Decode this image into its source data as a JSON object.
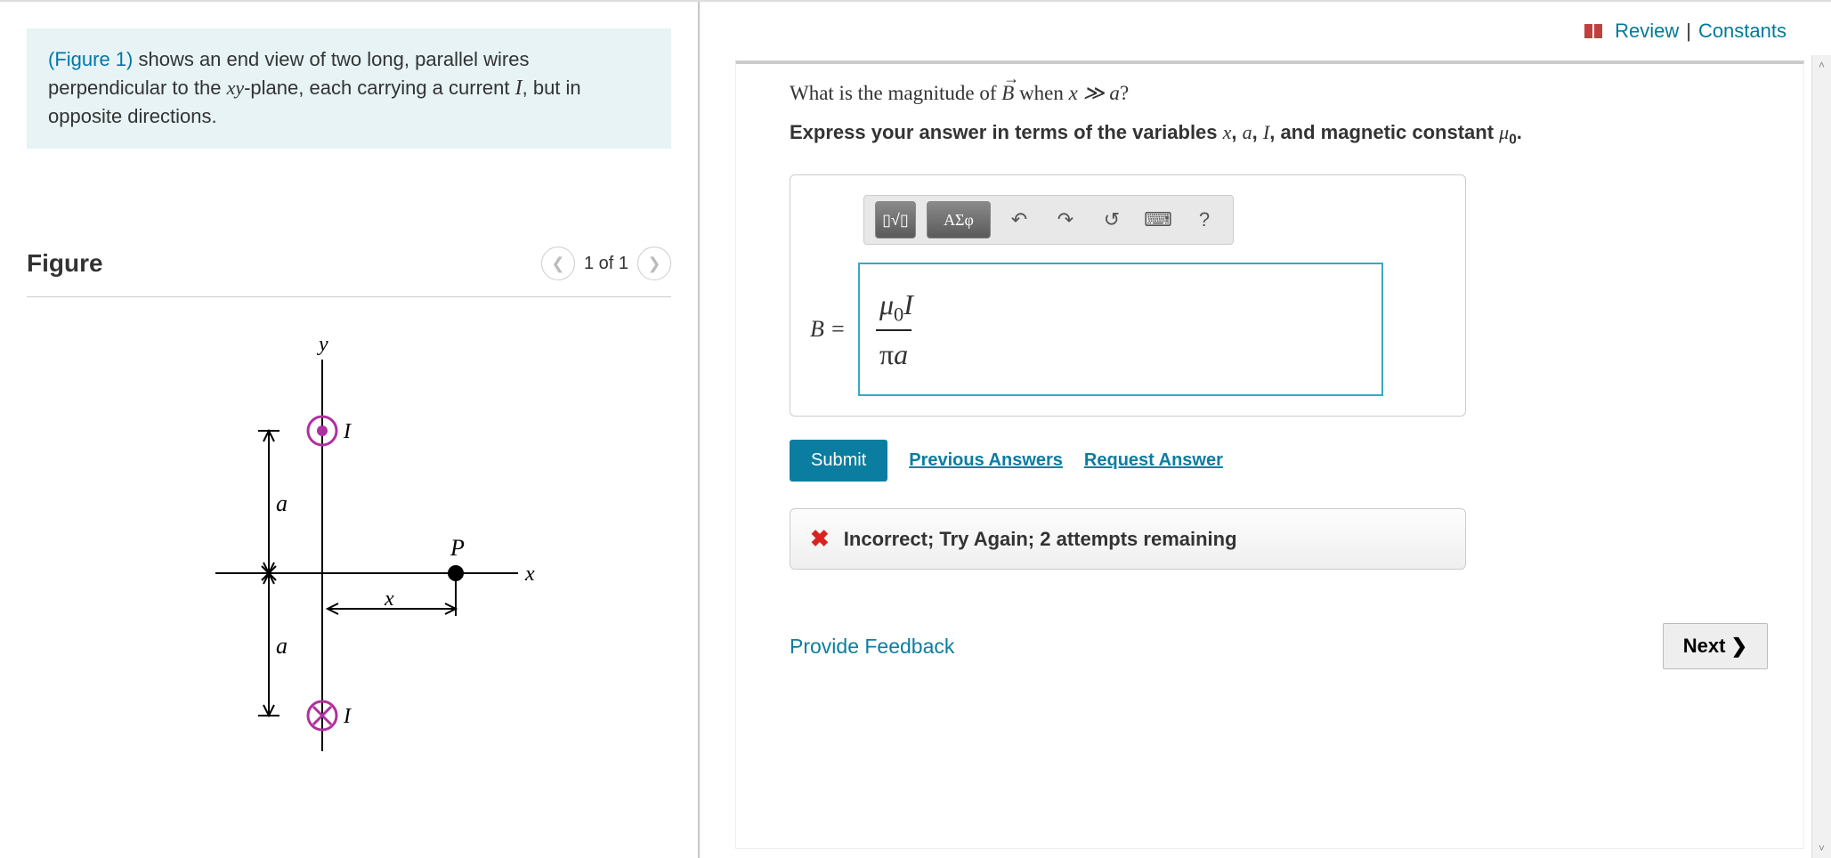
{
  "problem": {
    "figure_link": "(Figure 1)",
    "text_part1": " shows an end view of two long, parallel wires perpendicular to the ",
    "xy": "xy",
    "text_part2": "-plane, each carrying a current ",
    "I": "I",
    "text_part3": ", but in opposite directions."
  },
  "figure": {
    "title": "Figure",
    "counter": "1 of 1",
    "labels": {
      "y": "y",
      "x": "x",
      "a1": "a",
      "a2": "a",
      "xdim": "x",
      "P": "P",
      "I1": "I",
      "I2": "I"
    }
  },
  "top_links": {
    "review": "Review",
    "sep": " | ",
    "constants": "Constants"
  },
  "question": {
    "lead": "What is the magnitude of ",
    "Bvec": "B",
    "mid": " when ",
    "cond": "x ≫ a",
    "q": "?"
  },
  "instruction": {
    "lead": "Express your answer in terms of the variables ",
    "v1": "x",
    "c1": ", ",
    "v2": "a",
    "c2": ", ",
    "v3": "I",
    "c3": ", and magnetic constant ",
    "v4_mu": "μ",
    "v4_sub": "0",
    "end": "."
  },
  "toolbar": {
    "templates": "▯√▯",
    "greek": "ΑΣφ",
    "undo": "↶",
    "redo": "↷",
    "reset": "↺",
    "keyboard": "⌨",
    "help": "?"
  },
  "answer": {
    "label": "B = ",
    "numerator_mu": "μ",
    "numerator_sub": "0",
    "numerator_I": "I",
    "denominator_pi": "π",
    "denominator_a": "a"
  },
  "buttons": {
    "submit": "Submit",
    "previous": "Previous Answers",
    "request": "Request Answer"
  },
  "feedback": {
    "icon": "✖",
    "text": "Incorrect; Try Again; 2 attempts remaining"
  },
  "bottom": {
    "provide": "Provide Feedback",
    "next": "Next ❯"
  }
}
